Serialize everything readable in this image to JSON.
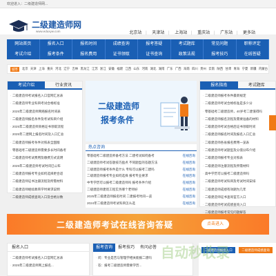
{
  "topbar": {
    "welcome": "欢迎进入：二级建造师网..."
  },
  "logo": {
    "title": "二级建造师网",
    "subtitle": "www.eduxyw.com"
  },
  "sites": [
    "北京站",
    "天津站",
    "上海站",
    "重庆站",
    "广东站"
  ],
  "sites_more": "更多站",
  "nav": {
    "row1": [
      "网站首页",
      "报名入口",
      "报名时间",
      "成绩查询",
      "报考答疑",
      "考试题库",
      "常见问题",
      "职称评定"
    ],
    "row2": [
      "考试介绍",
      "报考条件",
      "报名费用",
      "证书领取",
      "证书查询",
      "政策法规",
      "报考技巧",
      "在线答疑"
    ]
  },
  "cities": {
    "tag": "城市",
    "items": [
      "北京",
      "天津",
      "上海",
      "重庆",
      "河北",
      "辽宁",
      "吉林",
      "黑龙江",
      "江苏",
      "浙江",
      "安徽",
      "福建",
      "江西",
      "山东",
      "河南",
      "湖北",
      "湖南",
      "广东",
      "广西",
      "海南",
      "四川",
      "贵州",
      "云南",
      "陕西",
      "甘肃",
      "青海",
      "宁夏",
      "新疆",
      "内蒙古",
      "西藏",
      "全国"
    ]
  },
  "left": {
    "tabs": [
      "考试介绍",
      "行业资讯"
    ],
    "items": [
      "二级建造师考试报名入口官网汇总表",
      "二级建造师专业科目考试合格标准",
      "2025年二级建造师网络报名时间表",
      "二级建造师报名条件及考试科目介绍",
      "2025年二级建造师资格证书领取流程",
      "2025年二建网上报名时间及入口汇总",
      "二级建造师报考条件对照表全国版",
      "零基础考二级建造师需要多长时间备考",
      "二级建造师考试费用及缴费方式说明",
      "2025年二级建造师考试时间已公布",
      "二级建造师报考专业如何选择更合适",
      "二级建造师证书注册流程及所需材料",
      "二级建造师继续教育学时要求说明",
      "二级建造师成绩查询入口及合格分数"
    ]
  },
  "banner": {
    "line1": "二级建造师",
    "line2": "报考条件"
  },
  "hot": {
    "title": "热点咨询",
    "ask": "在线咨询",
    "items": [
      "零基础考二级建造师备考方法 二建考试如何备考",
      "二级建造师考试答题技巧盘点 不同题型的答题方法",
      "二级建造师报考条件是什么 专科可以报考二建吗",
      "二级建造师报考专业如何选择 报考专业要求",
      "中专学历可以报考二级建造师吗 报考条件介绍",
      "二级建造师建筑工程实务哪个老师好",
      "2025年二级建造师报名时间 二建报考时间一览",
      "2024年二级建造师考试科目怎么选"
    ]
  },
  "right": {
    "tabs": [
      "报名指南",
      "考试题库"
    ],
    "items": [
      "二级建造师报考条件最新规定",
      "二级建造师考试合格标准是多少分",
      "零基础考二级建造师，40岁考二建值得吗",
      "二级建造师报名流程及需要准备的材料",
      "二级建造师考试合格后证书领取时间",
      "二级建造师报名时间及报名入口汇总",
      "二级建造师各省报名费用一览表",
      "二级建造师考试题型及分值分布介绍",
      "二级建造师报考专业对照表",
      "二级建造师注册流程及所需材料",
      "高中学历可以报考二级建造师吗",
      "二级建造师考试科目及考试时间安排",
      "二级建造师成绩有效期为几年",
      "二级建造师证书查询官方入口",
      "二级建造师考试成绩查询入口",
      "二级建造师报考常见问题解答"
    ]
  },
  "promo": {
    "text": "二级建造师考试在线咨询答疑",
    "button": "点击进入"
  },
  "bottom": {
    "left_title": "报名入口",
    "left_items": [
      "二级建造师考试报名入口官网汇总表",
      "2025年二级建造师网上报名..."
    ],
    "mid_tabs": [
      "报考咨询",
      "报考技巧",
      "有问必答"
    ],
    "mid_items": [
      "问：专业是否与管理学相关能报二建吗",
      "答：报考二级建造师需要学历..."
    ],
    "btn1": "二级建造师报名入口",
    "btn2": "二级建造师成绩查询"
  },
  "watermark": "自动秒收录",
  "colors": {
    "primary": "#1a5fb4",
    "accent": "#f07a16"
  }
}
